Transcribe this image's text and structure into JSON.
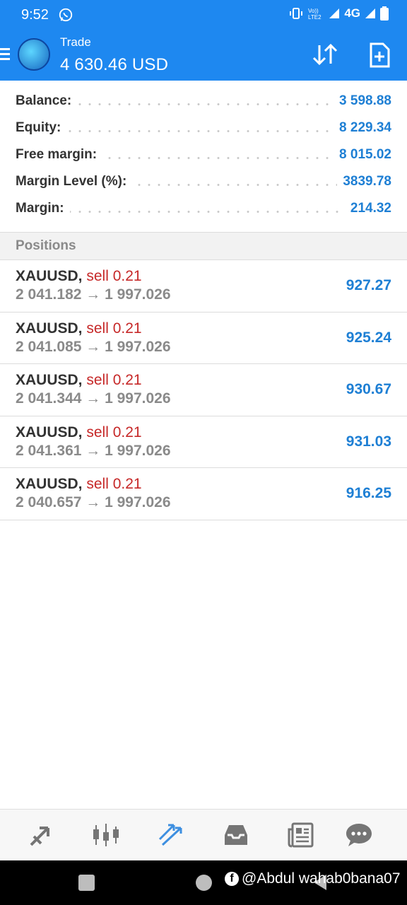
{
  "status_bar": {
    "time": "9:52",
    "network": "4G",
    "icons": [
      "whatsapp-icon",
      "vibrate-icon",
      "volte-icon",
      "signal-icon",
      "battery-icon"
    ]
  },
  "app_bar": {
    "title": "Trade",
    "subtitle": "4 630.46 USD",
    "icons": [
      "menu-icon",
      "metatrader-logo",
      "sort-icon",
      "new-order-icon"
    ]
  },
  "summary": [
    {
      "label": "Balance:",
      "value": "3 598.88"
    },
    {
      "label": "Equity:",
      "value": "8 229.34"
    },
    {
      "label": "Free margin:",
      "value": "8 015.02"
    },
    {
      "label": "Margin Level (%):",
      "value": "3839.78"
    },
    {
      "label": "Margin:",
      "value": "214.32"
    }
  ],
  "positions_header": "Positions",
  "positions": [
    {
      "symbol": "XAUUSD,",
      "side": "sell 0.21",
      "prices": "2 041.182 → 1 997.026",
      "profit": "927.27"
    },
    {
      "symbol": "XAUUSD,",
      "side": "sell 0.21",
      "prices": "2 041.085 → 1 997.026",
      "profit": "925.24"
    },
    {
      "symbol": "XAUUSD,",
      "side": "sell 0.21",
      "prices": "2 041.344 → 1 997.026",
      "profit": "930.67"
    },
    {
      "symbol": "XAUUSD,",
      "side": "sell 0.21",
      "prices": "2 041.361 → 1 997.026",
      "profit": "931.03"
    },
    {
      "symbol": "XAUUSD,",
      "side": "sell 0.21",
      "prices": "2 040.657 → 1 997.026",
      "profit": "916.25"
    }
  ],
  "tab_bar": {
    "tabs": [
      "quotes-tab-icon",
      "chart-tab-icon",
      "trade-tab-icon",
      "history-tab-icon",
      "news-tab-icon",
      "chat-tab-icon"
    ],
    "active": "trade-tab-icon",
    "active_color": "#3d8fe0",
    "inactive_color": "#757575"
  },
  "watermark": {
    "text": "@Abdul wahab0bana07",
    "icon": "facebook-icon"
  },
  "colors": {
    "header": "#1e88f0",
    "value_blue": "#1e7fd4",
    "sell_red": "#c62828"
  }
}
